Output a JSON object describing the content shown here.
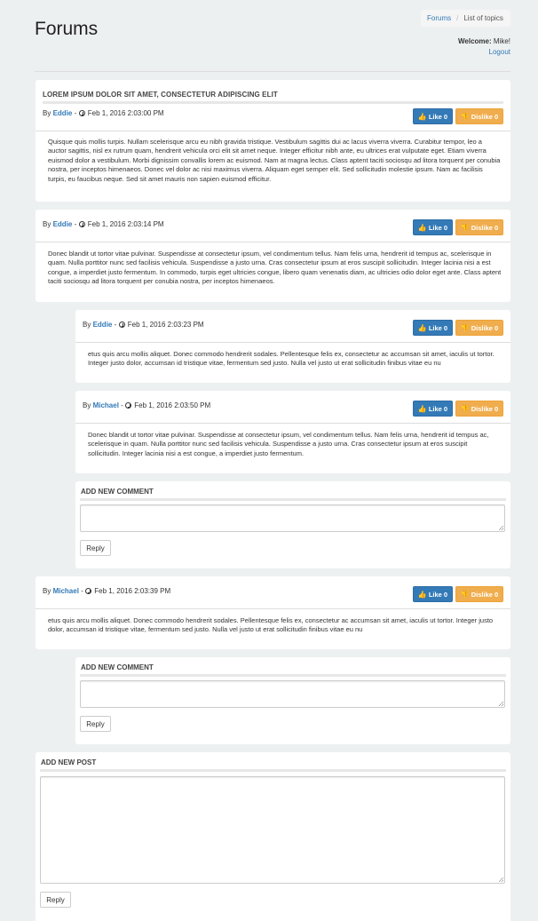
{
  "header": {
    "title": "Forums",
    "breadcrumb": {
      "link": "Forums",
      "current": "List of topics"
    },
    "welcome_label": "Welcome:",
    "welcome_user": "Mike!",
    "logout": "Logout"
  },
  "topic": {
    "title": "LOREM IPSUM DOLOR SIT AMET, CONSECTETUR ADIPISCING ELIT"
  },
  "common": {
    "by": "By",
    "dash": "-",
    "like": "Like 0",
    "dislike": "Dislike 0",
    "reply": "Reply",
    "add_comment": "ADD NEW COMMENT",
    "add_post": "ADD NEW POST"
  },
  "posts": [
    {
      "author": "Eddie",
      "date": "Feb 1, 2016 2:03:00 PM",
      "text": "Quisque quis mollis turpis. Nullam scelerisque arcu eu nibh gravida tristique. Vestibulum sagittis dui ac lacus viverra viverra. Curabitur tempor, leo a auctor sagittis, nisl ex rutrum quam, hendrerit vehicula orci elit sit amet neque. Integer efficitur nibh ante, eu ultrices erat vulputate eget. Etiam viverra euismod dolor a vestibulum. Morbi dignissim convallis lorem ac euismod. Nam at magna lectus. Class aptent taciti sociosqu ad litora torquent per conubia nostra, per inceptos himenaeos. Donec vel dolor ac nisi maximus viverra. Aliquam eget semper elit. Sed sollicitudin molestie ipsum. Nam ac facilisis turpis, eu faucibus neque. Sed sit amet mauris non sapien euismod efficitur."
    },
    {
      "author": "Eddie",
      "date": "Feb 1, 2016 2:03:14 PM",
      "text": "Donec blandit ut tortor vitae pulvinar. Suspendisse at consectetur ipsum, vel condimentum tellus. Nam felis urna, hendrerit id tempus ac, scelerisque in quam. Nulla porttitor nunc sed facilisis vehicula. Suspendisse a justo urna. Cras consectetur ipsum at eros suscipit sollicitudin. Integer lacinia nisi a est congue, a imperdiet justo fermentum. In commodo, turpis eget ultricies congue, libero quam venenatis diam, ac ultricies odio dolor eget ante. Class aptent taciti sociosqu ad litora torquent per conubia nostra, per inceptos himenaeos."
    },
    {
      "author": "Michael",
      "date": "Feb 1, 2016 2:03:39 PM",
      "text": "etus quis arcu mollis aliquet. Donec commodo hendrerit sodales. Pellentesque felis ex, consectetur ac accumsan sit amet, iaculis ut tortor. Integer justo dolor, accumsan id tristique vitae, fermentum sed justo. Nulla vel justo ut erat sollicitudin finibus vitae eu nu"
    }
  ],
  "comments": [
    {
      "author": "Eddie",
      "date": "Feb 1, 2016 2:03:23 PM",
      "text": "etus quis arcu mollis aliquet. Donec commodo hendrerit sodales. Pellentesque felis ex, consectetur ac accumsan sit amet, iaculis ut tortor. Integer justo dolor, accumsan id tristique vitae, fermentum sed justo. Nulla vel justo ut erat sollicitudin finibus vitae eu nu"
    },
    {
      "author": "Michael",
      "date": "Feb 1, 2016 2:03:50 PM",
      "text": "Donec blandit ut tortor vitae pulvinar. Suspendisse at consectetur ipsum, vel condimentum tellus. Nam felis urna, hendrerit id tempus ac, scelerisque in quam. Nulla porttitor nunc sed facilisis vehicula. Suspendisse a justo urna. Cras consectetur ipsum at eros suscipit sollicitudin. Integer lacinia nisi a est congue, a imperdiet justo fermentum."
    }
  ],
  "colors": {
    "primary": "#337ab7",
    "warning": "#f0ad4e",
    "background": "#edf0f1"
  },
  "icons": {
    "like": "thumbs-up-icon",
    "dislike": "thumbs-down-icon",
    "time": "clock-icon"
  }
}
